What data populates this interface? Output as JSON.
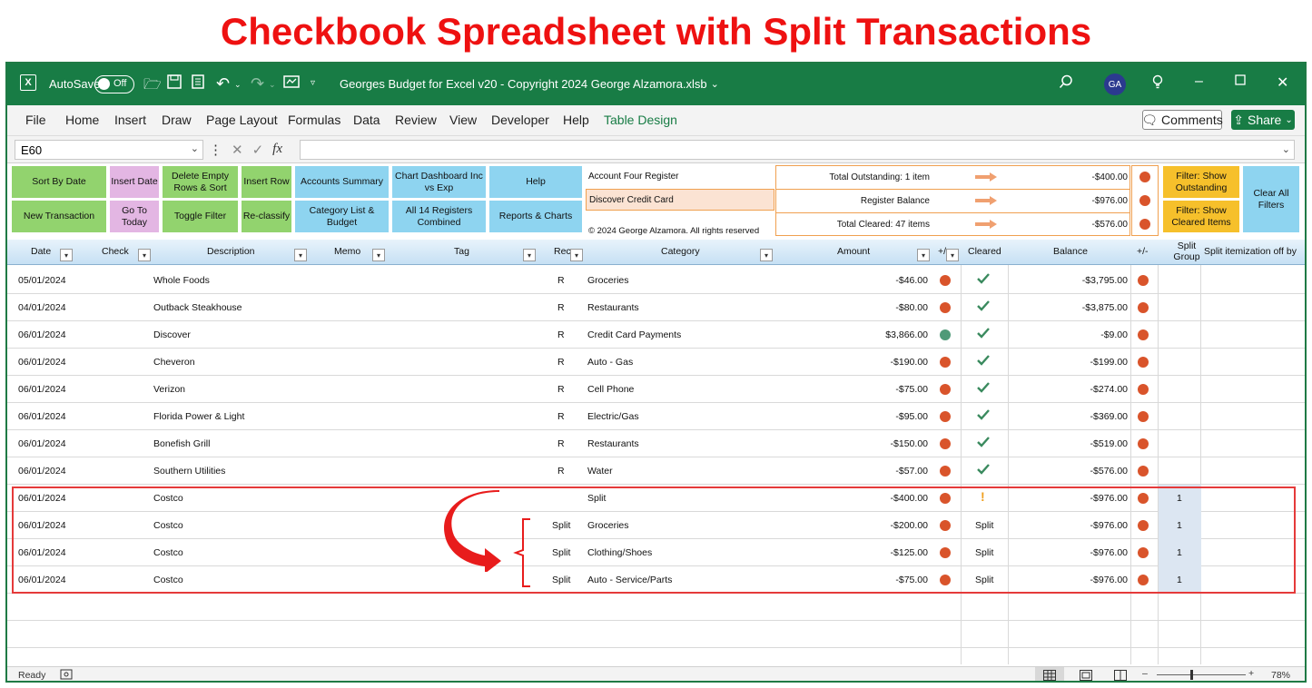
{
  "page_title": "Checkbook Spreadsheet with Split Transactions",
  "titlebar": {
    "autosave_label": "AutoSave",
    "toggle_state": "Off",
    "file_title": "Georges Budget for Excel v20 - Copyright 2024 George Alzamora.xlsb",
    "user_initials": "GA"
  },
  "menu": {
    "items": [
      "File",
      "Home",
      "Insert",
      "Draw",
      "Page Layout",
      "Formulas",
      "Data",
      "Review",
      "View",
      "Developer",
      "Help",
      "Table Design"
    ],
    "comments_label": "Comments",
    "share_label": "Share"
  },
  "formula_bar": {
    "name_box": "E60",
    "fx": "fx",
    "formula": ""
  },
  "control_panel": {
    "sort_by_date": "Sort By Date",
    "new_transaction": "New Transaction",
    "insert_date": "Insert Date",
    "go_to_today": "Go To Today",
    "delete_empty_rows": "Delete Empty Rows & Sort",
    "toggle_filter": "Toggle Filter",
    "insert_row": "Insert Row",
    "reclassify": "Re-classify",
    "accounts_summary": "Accounts Summary",
    "category_list": "Category List & Budget",
    "chart_dashboard": "Chart Dashboard Inc vs Exp",
    "all_registers": "All 14 Registers Combined",
    "help": "Help",
    "reports_charts": "Reports & Charts",
    "filter_outstanding": "Filter: Show Outstanding",
    "filter_cleared": "Filter: Show Cleared Items",
    "clear_filters": "Clear All Filters"
  },
  "info_panel": {
    "register_name": "Account Four Register",
    "account_name": "Discover Credit Card",
    "copyright": "© 2024 George Alzamora. All rights reserved",
    "total_outstanding_label": "Total Outstanding: 1 item",
    "total_outstanding_value": "-$400.00",
    "register_balance_label": "Register Balance",
    "register_balance_value": "-$976.00",
    "total_cleared_label": "Total Cleared: 47 items",
    "total_cleared_value": "-$576.00"
  },
  "table": {
    "headers": {
      "date": "Date",
      "check": "Check",
      "description": "Description",
      "memo": "Memo",
      "tag": "Tag",
      "rec": "Rec",
      "category": "Category",
      "amount": "Amount",
      "plusminus": "+/",
      "cleared": "Cleared",
      "balance": "Balance",
      "plusminus2": "+/-",
      "split_group": "Split Group",
      "split_item": "Split itemization off by"
    },
    "rows": [
      {
        "date": "05/01/2024",
        "description": "Whole Foods",
        "rec": "R",
        "category": "Groceries",
        "amount": "-$46.00",
        "cleared": "check",
        "balance": "-$3,795.00",
        "split": ""
      },
      {
        "date": "04/01/2024",
        "description": "Outback Steakhouse",
        "rec": "R",
        "category": "Restaurants",
        "amount": "-$80.00",
        "cleared": "check",
        "balance": "-$3,875.00",
        "split": ""
      },
      {
        "date": "06/01/2024",
        "description": "Discover",
        "rec": "R",
        "category": "Credit Card Payments",
        "amount": "$3,866.00",
        "cleared": "check",
        "balance": "-$9.00",
        "split": "",
        "dot": "green"
      },
      {
        "date": "06/01/2024",
        "description": "Cheveron",
        "rec": "R",
        "category": "Auto - Gas",
        "amount": "-$190.00",
        "cleared": "check",
        "balance": "-$199.00",
        "split": ""
      },
      {
        "date": "06/01/2024",
        "description": "Verizon",
        "rec": "R",
        "category": "Cell Phone",
        "amount": "-$75.00",
        "cleared": "check",
        "balance": "-$274.00",
        "split": ""
      },
      {
        "date": "06/01/2024",
        "description": "Florida Power & Light",
        "rec": "R",
        "category": "Electric/Gas",
        "amount": "-$95.00",
        "cleared": "check",
        "balance": "-$369.00",
        "split": ""
      },
      {
        "date": "06/01/2024",
        "description": "Bonefish Grill",
        "rec": "R",
        "category": "Restaurants",
        "amount": "-$150.00",
        "cleared": "check",
        "balance": "-$519.00",
        "split": ""
      },
      {
        "date": "06/01/2024",
        "description": "Southern Utilities",
        "rec": "R",
        "category": "Water",
        "amount": "-$57.00",
        "cleared": "check",
        "balance": "-$576.00",
        "split": ""
      },
      {
        "date": "06/01/2024",
        "description": "Costco",
        "rec": "",
        "category": "Split",
        "amount": "-$400.00",
        "cleared": "!",
        "balance": "-$976.00",
        "split": "1"
      },
      {
        "date": "06/01/2024",
        "description": "Costco",
        "rec": "Split",
        "category": "Groceries",
        "amount": "-$200.00",
        "cleared": "Split",
        "balance": "-$976.00",
        "split": "1"
      },
      {
        "date": "06/01/2024",
        "description": "Costco",
        "rec": "Split",
        "category": "Clothing/Shoes",
        "amount": "-$125.00",
        "cleared": "Split",
        "balance": "-$976.00",
        "split": "1"
      },
      {
        "date": "06/01/2024",
        "description": "Costco",
        "rec": "Split",
        "category": "Auto - Service/Parts",
        "amount": "-$75.00",
        "cleared": "Split",
        "balance": "-$976.00",
        "split": "1"
      }
    ]
  },
  "status": {
    "ready": "Ready",
    "zoom": "78%"
  },
  "colors": {
    "excel_green": "#187c45",
    "title_red": "#ee1111",
    "dot_orange": "#d9542b",
    "dot_green": "#4f9a78"
  }
}
